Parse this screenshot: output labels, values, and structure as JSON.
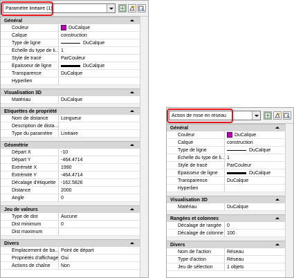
{
  "panel1": {
    "selector": "Paramètre linéaire (1)",
    "sections": [
      {
        "title": "Général",
        "rows": [
          {
            "label": "Couleur",
            "value": "DuCalque",
            "kind": "color"
          },
          {
            "label": "Calque",
            "value": "construction"
          },
          {
            "label": "Type de ligne",
            "value": "DuCalque",
            "kind": "line"
          },
          {
            "label": "Echelle du type de li...",
            "value": "1"
          },
          {
            "label": "Style de tracé",
            "value": "ParCouleur"
          },
          {
            "label": "Epaisseur de ligne",
            "value": "DuCalque",
            "kind": "thick"
          },
          {
            "label": "Transparence",
            "value": "DuCalque"
          },
          {
            "label": "Hyperlien",
            "value": ""
          }
        ]
      },
      {
        "title": "Visualisation 3D",
        "rows": [
          {
            "label": "Matériau",
            "value": "DuCalque"
          }
        ]
      },
      {
        "title": "Etiquettes de propriété",
        "rows": [
          {
            "label": "Nom de distance",
            "value": "Longueur"
          },
          {
            "label": "Description de dista...",
            "value": ""
          },
          {
            "label": "Type du paramètre",
            "value": "Linéaire"
          }
        ]
      },
      {
        "title": "Géométrie",
        "rows": [
          {
            "label": "Départ X",
            "value": "-10"
          },
          {
            "label": "Départ Y",
            "value": "-464.4714"
          },
          {
            "label": "Extrémité X",
            "value": "1990"
          },
          {
            "label": "Extrémité Y",
            "value": "-464.4714"
          },
          {
            "label": "Décalage d'étiquette",
            "value": "-162.5826"
          },
          {
            "label": "Distance",
            "value": "2000"
          },
          {
            "label": "Angle",
            "value": "0"
          }
        ]
      },
      {
        "title": "Jeu de valeurs",
        "rows": [
          {
            "label": "Type de dist",
            "value": "Aucune"
          },
          {
            "label": "Dist minimum",
            "value": "0"
          },
          {
            "label": "Dist maximum",
            "value": ""
          }
        ]
      },
      {
        "title": "Divers",
        "rows": [
          {
            "label": "Emplacement de ba...",
            "value": "Point de départ"
          },
          {
            "label": "Propriétés d'affichage",
            "value": "Oui"
          },
          {
            "label": "Actions de chaîne",
            "value": "Non"
          }
        ]
      }
    ]
  },
  "panel2": {
    "selector": "Action de mise en réseau",
    "sections": [
      {
        "title": "Général",
        "rows": [
          {
            "label": "Couleur",
            "value": "DuCalque",
            "kind": "color"
          },
          {
            "label": "Calque",
            "value": "construction"
          },
          {
            "label": "Type de ligne",
            "value": "DuCalque",
            "kind": "line"
          },
          {
            "label": "Echelle du type de li...",
            "value": "1"
          },
          {
            "label": "Style de tracé",
            "value": "ParCouleur"
          },
          {
            "label": "Epaisseur de ligne",
            "value": "DuCalque",
            "kind": "thick"
          },
          {
            "label": "Transparence",
            "value": "DuCalque"
          },
          {
            "label": "Hyperlien",
            "value": ""
          }
        ]
      },
      {
        "title": "Visualisation 3D",
        "rows": [
          {
            "label": "Matériau",
            "value": "DuCalque"
          }
        ]
      },
      {
        "title": "Rangées et colonnes",
        "rows": [
          {
            "label": "Décalage de rangée",
            "value": "0"
          },
          {
            "label": "Décalage de colonne",
            "value": "100"
          }
        ]
      },
      {
        "title": "Divers",
        "rows": [
          {
            "label": "Nom de l'action",
            "value": "Réseau"
          },
          {
            "label": "Type d'action",
            "value": "Réseau"
          },
          {
            "label": "Jeu de sélection",
            "value": "1 objets"
          }
        ]
      }
    ]
  },
  "colors": {
    "highlight": "#e8141c",
    "swatch": "#c000c0"
  },
  "icons": [
    "add-selection-icon",
    "quick-select-icon",
    "toggle-pickadd-icon"
  ]
}
